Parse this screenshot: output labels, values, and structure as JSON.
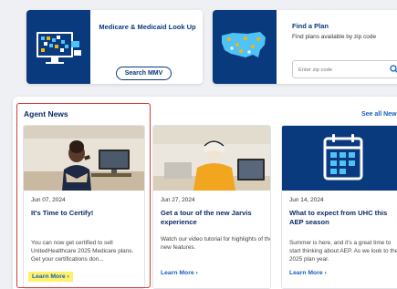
{
  "tiles": {
    "mmv": {
      "title": "Medicare & Medicaid Look Up",
      "button": "Search MMV"
    },
    "plan": {
      "title": "Find a Plan",
      "subtitle": "Find plans available by zip code",
      "zip_placeholder": "Enter zip code"
    }
  },
  "news": {
    "heading": "Agent News",
    "see_all": "See all New",
    "cards": [
      {
        "date": "Jun 07, 2024",
        "title": "It's Time to Certify!",
        "body": "You can now get certified to sell UnitedHealthcare 2025 Medicare plans. Get your certifications don...",
        "link": "Learn More  ›",
        "highlighted": true
      },
      {
        "date": "Jun 27, 2024",
        "title": "Get a tour of the new Jarvis experience",
        "body": "Watch our video tutorial for highlights of the new features.",
        "link": "Learn More  ›",
        "highlighted": false
      },
      {
        "date": "Jun 14, 2024",
        "title": "What to expect from UHC this AEP season",
        "body": "Summer is here, and it's a great time to start thinking about AEP. As we look to the 2025 plan year.",
        "link": "Learn More  ›",
        "highlighted": false
      }
    ]
  },
  "colors": {
    "brand_navy": "#0a3a7e",
    "link_blue": "#1560c0",
    "highlight_red": "#d93a3a",
    "highlight_yellow": "#fff26b"
  }
}
